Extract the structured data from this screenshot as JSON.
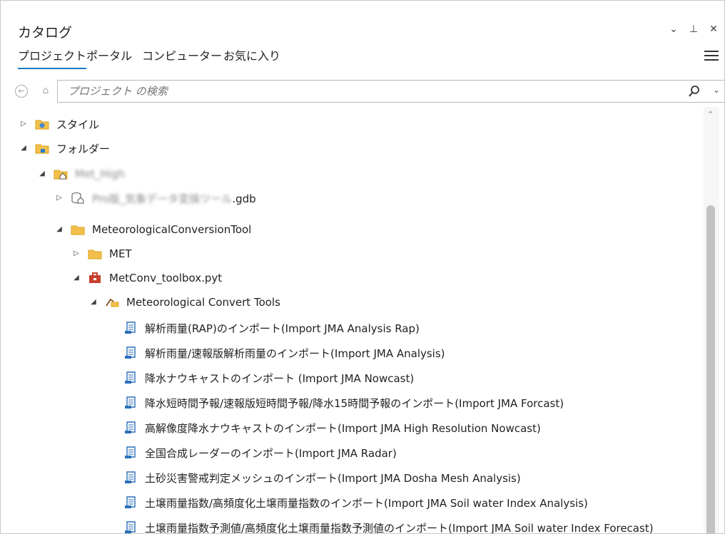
{
  "pane": {
    "title": "カタログ"
  },
  "tabs": [
    "プロジェクト",
    "ポータル",
    "コンピューター",
    "お気に入り"
  ],
  "search": {
    "placeholder": "プロジェクト の検索"
  },
  "tree": {
    "styles": "スタイル",
    "folders": "フォルダー",
    "met_high": "Met_High",
    "gdb_blur": "Pro版_気象データ変換ツール",
    "gdb_suffix": ".gdb",
    "met_conv_tool": "MeteorologicalConversionTool",
    "met": "MET",
    "toolbox": "MetConv_toolbox.pyt",
    "toolset": "Meteorological Convert Tools",
    "tools": [
      "解析雨量(RAP)のインポート(Import JMA Analysis Rap)",
      "解析雨量/速報版解析雨量のインポート(Import JMA Analysis)",
      "降水ナウキャストのインポート (Import JMA Nowcast)",
      "降水短時間予報/速報版短時間予報/降水15時間予報のインポート(Import JMA Forcast)",
      "高解像度降水ナウキャストのインポート(Import JMA High Resolution Nowcast)",
      "全国合成レーダーのインポート(Import JMA Radar)",
      "土砂災害警戒判定メッシュのインポート(Import JMA Dosha Mesh Analysis)",
      "土壌雨量指数/高頻度化土壌雨量指数のインポート(Import JMA Soil water Index Analysis)",
      "土壌雨量指数予測値/高頻度化土壌雨量指数予測値のインポート(Import JMA Soil water Index Forecast)"
    ]
  },
  "colors": {
    "accent": "#1b78c8",
    "folder": "#f2c04a",
    "folder_dark": "#d9a21b",
    "toolbox_red": "#c8402e"
  }
}
